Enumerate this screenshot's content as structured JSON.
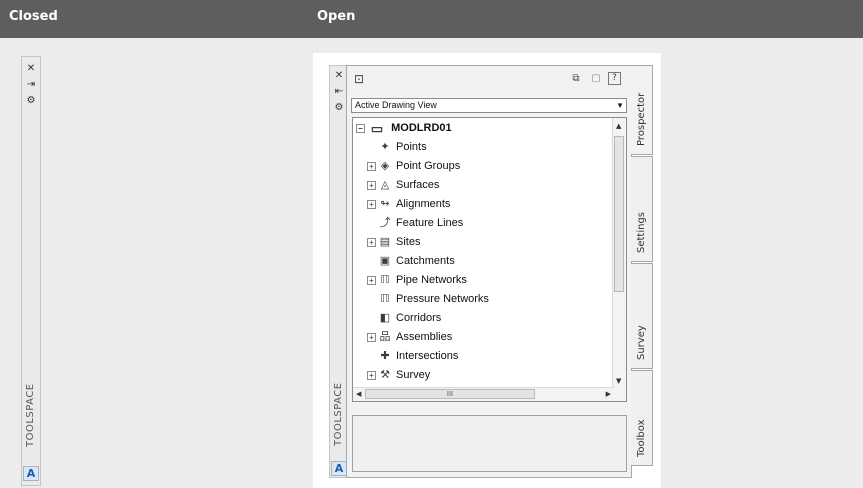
{
  "header": {
    "closed_label": "Closed",
    "open_label": "Open"
  },
  "closed_palette": {
    "close_glyph": "✕",
    "autohide_glyph": "⇥",
    "properties_glyph": "⚙",
    "title": "TOOLSPACE",
    "logo_letter": "A"
  },
  "open_palette": {
    "close_glyph": "✕",
    "autohide_glyph": "⇤",
    "properties_glyph": "⚙",
    "title": "TOOLSPACE",
    "logo_letter": "A",
    "dropdown": {
      "value": "Active Drawing View",
      "arrow": "▼"
    },
    "tree": {
      "root": {
        "label": "MODLRD01",
        "expander": "⊟"
      },
      "items": [
        {
          "label": "Points",
          "expander": "",
          "icon": "✦"
        },
        {
          "label": "Point Groups",
          "expander": "+",
          "icon": "◈"
        },
        {
          "label": "Surfaces",
          "expander": "+",
          "icon": "◬"
        },
        {
          "label": "Alignments",
          "expander": "+",
          "icon": "↬"
        },
        {
          "label": "Feature Lines",
          "expander": "",
          "icon": "⤴"
        },
        {
          "label": "Sites",
          "expander": "+",
          "icon": "▤"
        },
        {
          "label": "Catchments",
          "expander": "",
          "icon": "▣"
        },
        {
          "label": "Pipe Networks",
          "expander": "+",
          "icon": "ℿ"
        },
        {
          "label": "Pressure Networks",
          "expander": "",
          "icon": "ℿ"
        },
        {
          "label": "Corridors",
          "expander": "",
          "icon": "◧"
        },
        {
          "label": "Assemblies",
          "expander": "+",
          "icon": "品"
        },
        {
          "label": "Intersections",
          "expander": "",
          "icon": "✚"
        },
        {
          "label": "Survey",
          "expander": "+",
          "icon": "⚒"
        }
      ]
    },
    "tabs": [
      "Prospector",
      "Settings",
      "Survey",
      "Toolbox"
    ]
  }
}
